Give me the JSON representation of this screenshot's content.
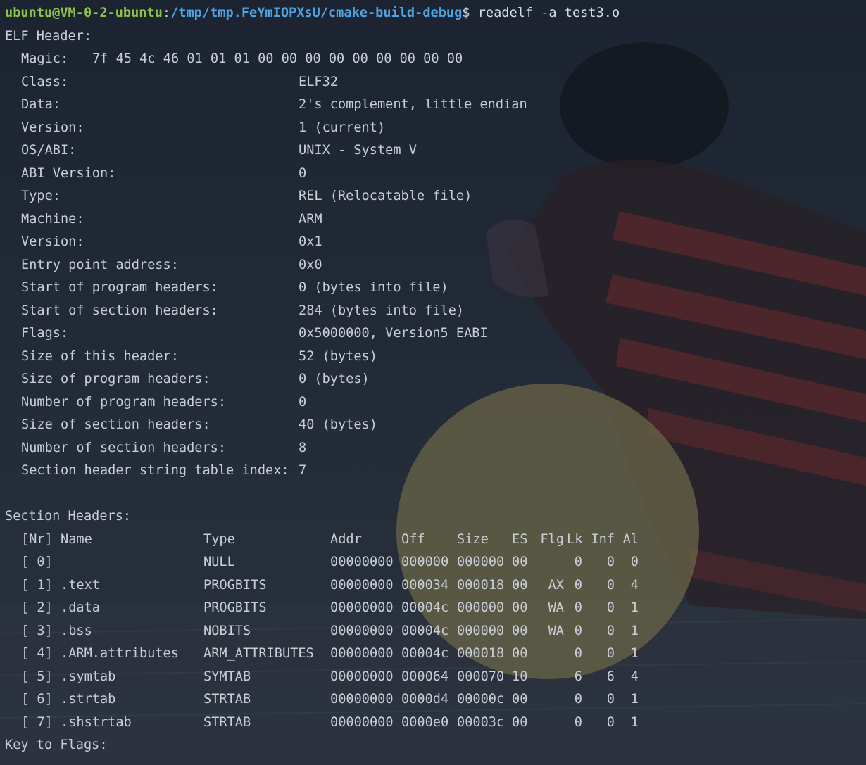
{
  "prompt": {
    "user_host": "ubuntu@VM-0-2-ubuntu",
    "separator": ":",
    "path": "/tmp/tmp.FeYmIOPXsU/cmake-build-debug",
    "sign": "$ ",
    "command": "readelf -a test3.o"
  },
  "elf_header": {
    "heading": "ELF Header:",
    "magic_label": "Magic:",
    "magic_value": "7f 45 4c 46 01 01 01 00 00 00 00 00 00 00 00 00",
    "fields": [
      {
        "label": "Class:",
        "value": "ELF32"
      },
      {
        "label": "Data:",
        "value": "2's complement, little endian"
      },
      {
        "label": "Version:",
        "value": "1 (current)"
      },
      {
        "label": "OS/ABI:",
        "value": "UNIX - System V"
      },
      {
        "label": "ABI Version:",
        "value": "0"
      },
      {
        "label": "Type:",
        "value": "REL (Relocatable file)"
      },
      {
        "label": "Machine:",
        "value": "ARM"
      },
      {
        "label": "Version:",
        "value": "0x1"
      },
      {
        "label": "Entry point address:",
        "value": "0x0"
      },
      {
        "label": "Start of program headers:",
        "value": "0 (bytes into file)"
      },
      {
        "label": "Start of section headers:",
        "value": "284 (bytes into file)"
      },
      {
        "label": "Flags:",
        "value": "0x5000000, Version5 EABI"
      },
      {
        "label": "Size of this header:",
        "value": "52 (bytes)"
      },
      {
        "label": "Size of program headers:",
        "value": "0 (bytes)"
      },
      {
        "label": "Number of program headers:",
        "value": "0"
      },
      {
        "label": "Size of section headers:",
        "value": "40 (bytes)"
      },
      {
        "label": "Number of section headers:",
        "value": "8"
      },
      {
        "label": "Section header string table index:",
        "value": "7"
      }
    ]
  },
  "section_headers": {
    "heading": "Section Headers:",
    "columns": {
      "nr": "[Nr]",
      "name": "Name",
      "type": "Type",
      "addr": "Addr",
      "off": "Off",
      "size": "Size",
      "es": "ES",
      "flg": "Flg",
      "lk": "Lk",
      "inf": "Inf",
      "al": "Al"
    },
    "rows": [
      {
        "nr": "[ 0]",
        "name": "",
        "type": "NULL",
        "addr": "00000000",
        "off": "000000",
        "size": "000000",
        "es": "00",
        "flg": "",
        "lk": "0",
        "inf": "0",
        "al": "0"
      },
      {
        "nr": "[ 1]",
        "name": ".text",
        "type": "PROGBITS",
        "addr": "00000000",
        "off": "000034",
        "size": "000018",
        "es": "00",
        "flg": "AX",
        "lk": "0",
        "inf": "0",
        "al": "4"
      },
      {
        "nr": "[ 2]",
        "name": ".data",
        "type": "PROGBITS",
        "addr": "00000000",
        "off": "00004c",
        "size": "000000",
        "es": "00",
        "flg": "WA",
        "lk": "0",
        "inf": "0",
        "al": "1"
      },
      {
        "nr": "[ 3]",
        "name": ".bss",
        "type": "NOBITS",
        "addr": "00000000",
        "off": "00004c",
        "size": "000000",
        "es": "00",
        "flg": "WA",
        "lk": "0",
        "inf": "0",
        "al": "1"
      },
      {
        "nr": "[ 4]",
        "name": ".ARM.attributes",
        "type": "ARM_ATTRIBUTES",
        "addr": "00000000",
        "off": "00004c",
        "size": "000018",
        "es": "00",
        "flg": "",
        "lk": "0",
        "inf": "0",
        "al": "1"
      },
      {
        "nr": "[ 5]",
        "name": ".symtab",
        "type": "SYMTAB",
        "addr": "00000000",
        "off": "000064",
        "size": "000070",
        "es": "10",
        "flg": "",
        "lk": "6",
        "inf": "6",
        "al": "4"
      },
      {
        "nr": "[ 6]",
        "name": ".strtab",
        "type": "STRTAB",
        "addr": "00000000",
        "off": "0000d4",
        "size": "00000c",
        "es": "00",
        "flg": "",
        "lk": "0",
        "inf": "0",
        "al": "1"
      },
      {
        "nr": "[ 7]",
        "name": ".shstrtab",
        "type": "STRTAB",
        "addr": "00000000",
        "off": "0000e0",
        "size": "00003c",
        "es": "00",
        "flg": "",
        "lk": "0",
        "inf": "0",
        "al": "1"
      }
    ]
  },
  "key_to_flags": "Key to Flags:",
  "colors": {
    "prompt_user": "#8bc34a",
    "prompt_path": "#4fa3e0",
    "text": "#c9ced6",
    "background": "#1f2532"
  }
}
